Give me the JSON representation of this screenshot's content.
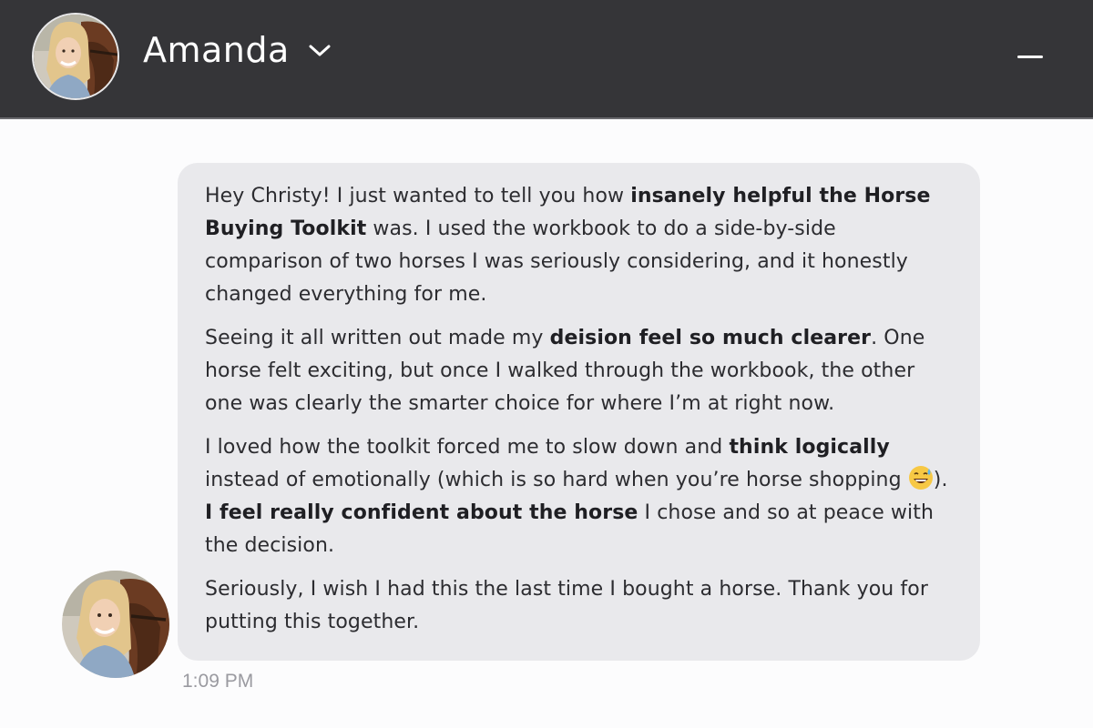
{
  "header": {
    "contact_name": "Amanda",
    "avatar_icon": "user-avatar-with-horse",
    "dropdown_icon": "chevron-down-icon",
    "minimize_icon": "minimize-icon"
  },
  "message": {
    "p1_a": "Hey Christy! I just wanted to tell you how ",
    "p1_b": "insanely helpful the Horse Buying Toolkit",
    "p1_c": " was. I used the workbook to do a side-by-side comparison of two horses I was seriously considering, and it honestly changed everything for me.",
    "p2_a": "Seeing it all written out made my ",
    "p2_b": "deision feel so much clearer",
    "p2_c": ". One horse felt exciting, but once I walked through the workbook, the other one was clearly the smarter choice for where I’m at right now.",
    "p3_a": "I loved how the toolkit forced me to slow down and ",
    "p3_b": "think logically",
    "p3_c": " instead of emotionally (which is so hard when you’re horse shopping ",
    "p3_d": "). ",
    "p3_e": "I feel really confident about the horse",
    "p3_f": " I chose and so at peace with the decision.",
    "p4": "Seriously, I wish I had this the last time I bought a horse. Thank you for putting this together.",
    "emoji": "grinning-sweat-emoji",
    "timestamp": "1:09 PM"
  },
  "colors": {
    "header_bg": "#353538",
    "bubble_bg": "#e9e9ec",
    "page_bg": "#fcfcfd",
    "text": "#2c2c30",
    "timestamp": "#9a9aa0"
  }
}
